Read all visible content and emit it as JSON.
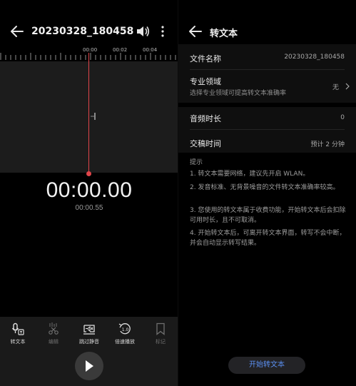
{
  "left": {
    "title": "20230328_180458",
    "timeline_ticks": [
      "00:00",
      "00:02",
      "00:04"
    ],
    "timer": "00:00.00",
    "subtimer": "00:00.55",
    "tools": [
      {
        "label": "转文本",
        "icon": "speech-to-text-icon",
        "enabled": true
      },
      {
        "label": "编辑",
        "icon": "scissors-icon",
        "enabled": false
      },
      {
        "label": "跳过静音",
        "icon": "skip-silence-icon",
        "enabled": true
      },
      {
        "label": "倍速播放",
        "icon": "speed-icon",
        "enabled": true
      },
      {
        "label": "标记",
        "icon": "bookmark-icon",
        "enabled": false
      }
    ],
    "play_icon": "play-icon"
  },
  "right": {
    "title": "转文本",
    "file_name_label": "文件名称",
    "file_name_value": "20230328_180458",
    "domain_label": "专业领域",
    "domain_sub": "选择专业领域可提高转文本准确率",
    "domain_value": "无",
    "duration_label": "音频时长",
    "duration_value": "0",
    "delivery_label": "交稿时间",
    "delivery_value": "预计 2 分钟",
    "tips_title": "提示",
    "tips": [
      "1. 转文本需要网络，建议先开启 WLAN。",
      "2. 发音标准、无背景噪音的文件转文本准确率较高。",
      "3. 您使用的转文本属于收费功能，开始转文本后会扣除可用时长，且不可取消。",
      "4. 开始转文本后，可离开转文本界面，转写不会中断，并会自动显示转写结果。"
    ],
    "start_button": "开始转文本"
  },
  "colors": {
    "accent": "#5b8ff0",
    "playhead": "#e0454a",
    "background": "#000000"
  }
}
